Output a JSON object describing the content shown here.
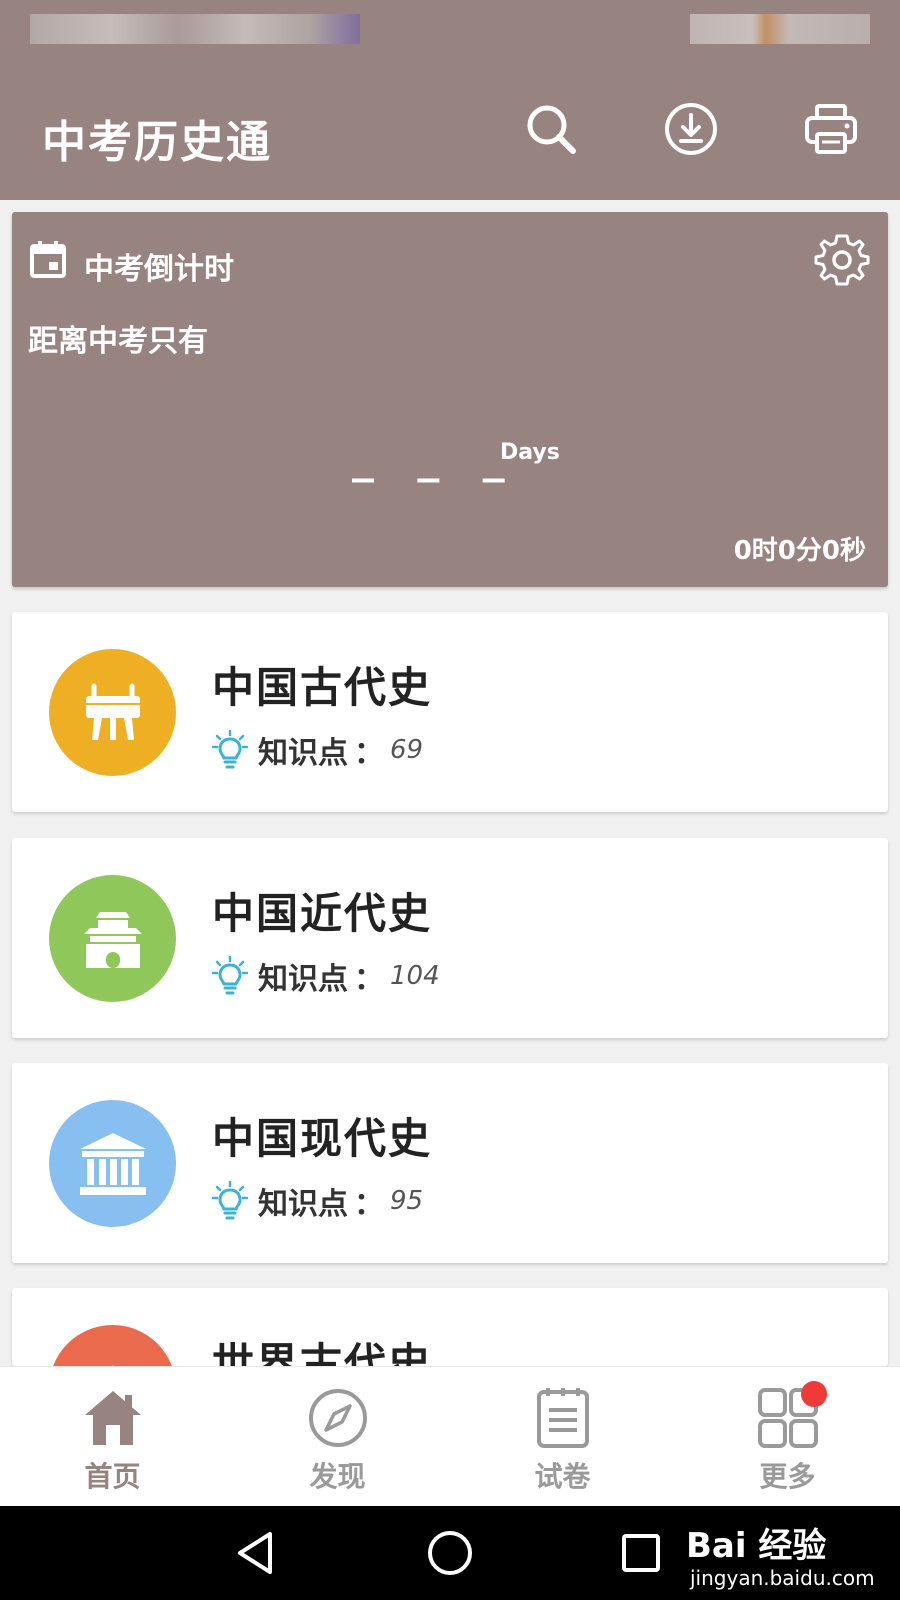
{
  "app": {
    "title": "中考历史通"
  },
  "toolbar": {
    "icons": [
      "search-icon",
      "download-icon",
      "print-icon"
    ]
  },
  "countdown": {
    "title": "中考倒计时",
    "subtitle": "距离中考只有",
    "days_value": "_ _ _",
    "days_label": "Days",
    "time": "0时0分0秒"
  },
  "cards": [
    {
      "title": "中国古代史",
      "meta_label": "知识点",
      "meta_colon": "：",
      "count": "69",
      "color": "#eeaf25",
      "icon": "ding-vessel-icon"
    },
    {
      "title": "中国近代史",
      "meta_label": "知识点",
      "meta_colon": "：",
      "count": "104",
      "color": "#8fc75b",
      "icon": "pavilion-icon"
    },
    {
      "title": "中国现代史",
      "meta_label": "知识点",
      "meta_colon": "：",
      "count": "95",
      "color": "#86bff0",
      "icon": "building-icon"
    },
    {
      "title": "世界古代史",
      "color": "#ea6a4d",
      "icon": "pyramid-icon"
    }
  ],
  "bottom_nav": [
    {
      "label": "首页",
      "icon": "home-icon",
      "active": true
    },
    {
      "label": "发现",
      "icon": "compass-icon",
      "active": false
    },
    {
      "label": "试卷",
      "icon": "paper-icon",
      "active": false
    },
    {
      "label": "更多",
      "icon": "grid-icon",
      "active": false
    }
  ],
  "watermark": {
    "top": "Bai 经验",
    "bottom": "jingyan.baidu.com"
  },
  "colors": {
    "primary": "#978380",
    "badge": "#f03a3a",
    "bulb": "#3bb3d6"
  }
}
